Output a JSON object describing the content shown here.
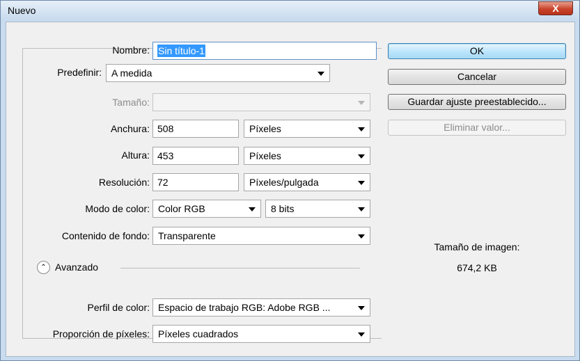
{
  "window": {
    "title": "Nuevo",
    "close_glyph": "X"
  },
  "name": {
    "label": "Nombre:",
    "value": "Sin título-1"
  },
  "preset": {
    "label": "Predefinir:",
    "value": "A medida"
  },
  "size": {
    "label": "Tamaño:",
    "value": ""
  },
  "width": {
    "label": "Anchura:",
    "value": "508",
    "unit": "Píxeles"
  },
  "height": {
    "label": "Altura:",
    "value": "453",
    "unit": "Píxeles"
  },
  "resolution": {
    "label": "Resolución:",
    "value": "72",
    "unit": "Píxeles/pulgada"
  },
  "color_mode": {
    "label": "Modo de color:",
    "value": "Color RGB",
    "bits": "8 bits"
  },
  "background": {
    "label": "Contenido de fondo:",
    "value": "Transparente"
  },
  "advanced": {
    "label": "Avanzado",
    "icon": "collapse-up-icon"
  },
  "color_profile": {
    "label": "Perfil de color:",
    "value": "Espacio de trabajo RGB: Adobe RGB ..."
  },
  "pixel_aspect": {
    "label": "Proporción de píxeles:",
    "value": "Píxeles cuadrados"
  },
  "buttons": {
    "ok": "OK",
    "cancel": "Cancelar",
    "save_preset": "Guardar ajuste preestablecido...",
    "delete_preset": "Eliminar valor..."
  },
  "image_size": {
    "label": "Tamaño de imagen:",
    "value": "674,2 KB"
  },
  "colors": {
    "title_bar": "#c7daee",
    "close_button": "#c9442b",
    "selection": "#3399ff",
    "ok_button": "#bee6fd"
  }
}
